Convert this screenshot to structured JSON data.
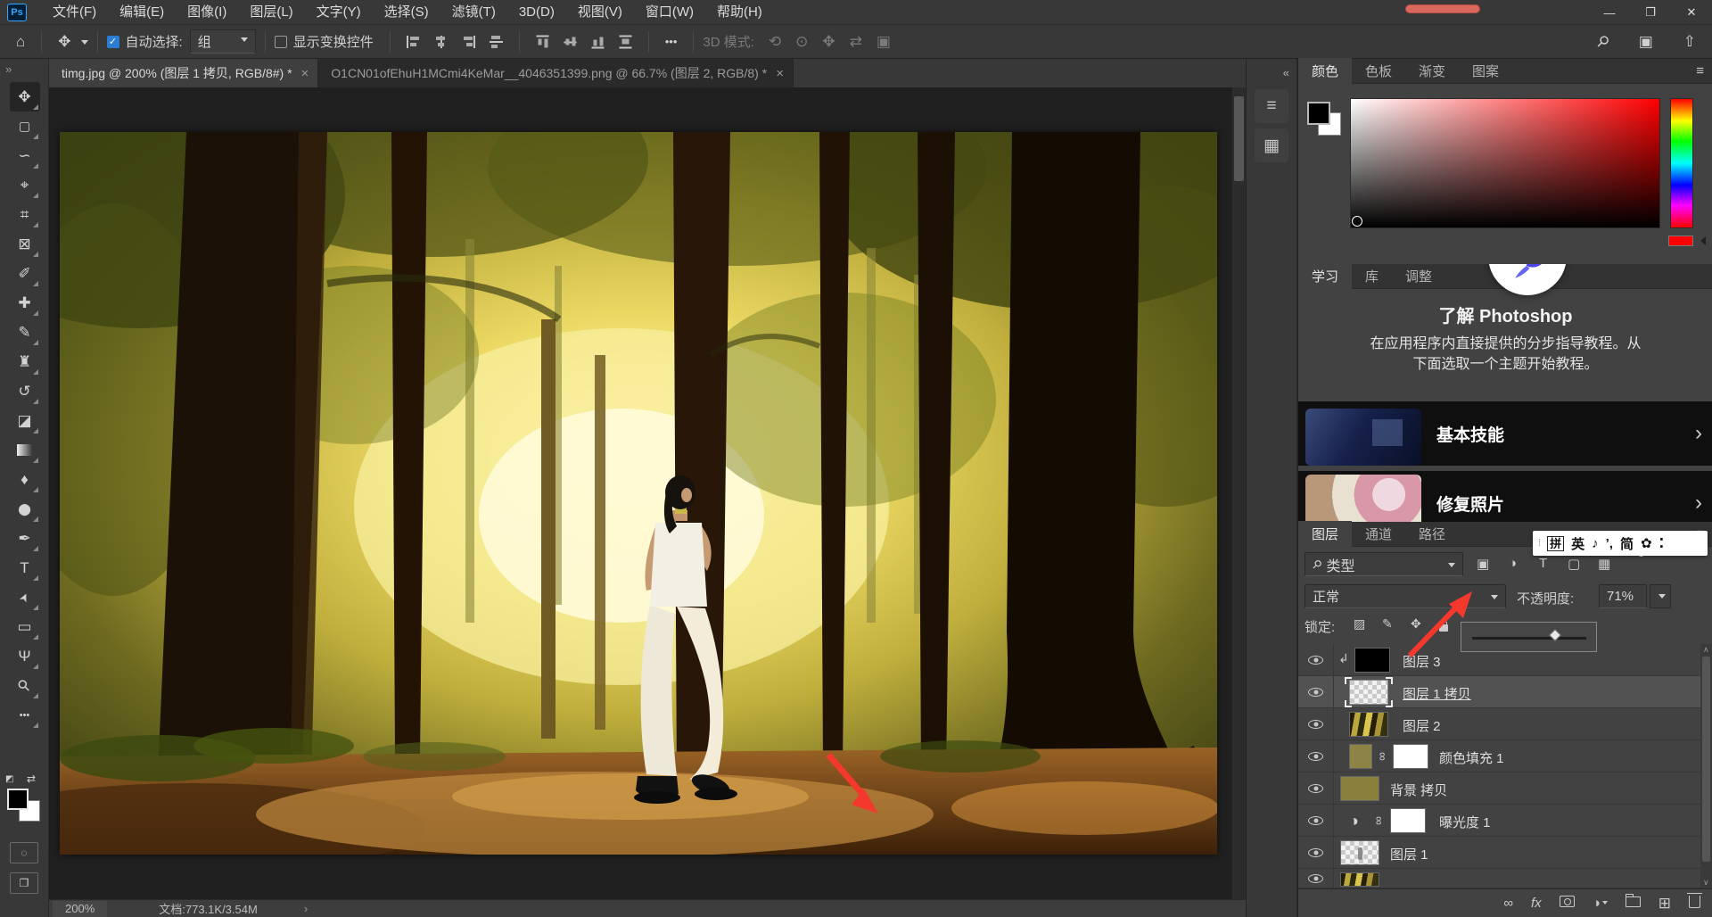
{
  "window": {
    "logo": "Ps",
    "controls": {
      "minimize": "—",
      "restore": "❐",
      "close": "✕"
    }
  },
  "menu": {
    "items": [
      "文件(F)",
      "编辑(E)",
      "图像(I)",
      "图层(L)",
      "文字(Y)",
      "选择(S)",
      "滤镜(T)",
      "3D(D)",
      "视图(V)",
      "窗口(W)",
      "帮助(H)"
    ]
  },
  "options": {
    "home_glyph": "⌂",
    "move_glyph": "✥",
    "check_glyph": "✓",
    "auto_select_label": "自动选择:",
    "auto_select_value": "组",
    "show_transform_label": "显示变换控件",
    "more_glyph": "•••",
    "mode3d_label": "3D 模式:",
    "mode3d_icons": [
      "⟲",
      "⊙",
      "✥",
      "⇄",
      "▣"
    ],
    "right_icons": {
      "search": "⚲",
      "workspace": "▣",
      "share": "⇧"
    }
  },
  "tabs": [
    {
      "title": "timg.jpg @ 200% (图层 1 拷贝, RGB/8#) *",
      "close_glyph": "×",
      "active": true
    },
    {
      "title": "O1CN01ofEhuH1MCmi4KeMar__4046351399.png @ 66.7% (图层 2, RGB/8) *",
      "close_glyph": "×",
      "active": false
    }
  ],
  "toolbar": {
    "collapse_glyph": "»",
    "tools": [
      {
        "name": "move",
        "glyph": "✥"
      },
      {
        "name": "rectangular-marquee",
        "glyph": "▢"
      },
      {
        "name": "lasso",
        "glyph": "∽"
      },
      {
        "name": "object-selection",
        "glyph": "⌖"
      },
      {
        "name": "crop",
        "glyph": "⌗"
      },
      {
        "name": "frame",
        "glyph": "⊠"
      },
      {
        "name": "eyedropper",
        "glyph": "✐"
      },
      {
        "name": "spot-healing-brush",
        "glyph": "✚"
      },
      {
        "name": "brush",
        "glyph": "✎"
      },
      {
        "name": "clone-stamp",
        "glyph": "♜"
      },
      {
        "name": "history-brush",
        "glyph": "↺"
      },
      {
        "name": "eraser",
        "glyph": "◪"
      },
      {
        "name": "gradient",
        "glyph": "■"
      },
      {
        "name": "blur",
        "glyph": "♦"
      },
      {
        "name": "dodge",
        "glyph": "⬤"
      },
      {
        "name": "pen",
        "glyph": "✒"
      },
      {
        "name": "horizontal-type",
        "glyph": "T"
      },
      {
        "name": "path-selection",
        "glyph": "➤"
      },
      {
        "name": "rectangle",
        "glyph": "▭"
      },
      {
        "name": "hand",
        "glyph": "Ψ"
      },
      {
        "name": "zoom",
        "glyph": "⚲"
      },
      {
        "name": "edit-toolbar",
        "glyph": "•••"
      }
    ],
    "quick_mask_glyph": "◌",
    "screen_mode_glyph": "❐"
  },
  "dock": {
    "collapse_glyph": "«",
    "icon1": "≡",
    "icon2": "▦"
  },
  "color_panel": {
    "tabs": [
      "颜色",
      "色板",
      "渐变",
      "图案"
    ],
    "menu_glyph": "≡",
    "fg_color": "#000000",
    "bg_color": "#ffffff",
    "hue_selected": "#ff0000"
  },
  "learn_panel": {
    "tabs": [
      "学习",
      "库",
      "调整"
    ],
    "heading": "了解 Photoshop",
    "body_line1": "在应用程序内直接提供的分步指导教程。从",
    "body_line2": "下面选取一个主题开始教程。",
    "cards": [
      {
        "title": "基本技能",
        "chevron": "›"
      },
      {
        "title": "修复照片",
        "chevron": "›"
      }
    ]
  },
  "layers_panel": {
    "tabs": [
      "图层",
      "通道",
      "路径"
    ],
    "menu_glyph": "≡",
    "search_glyph": "⚲",
    "filter_label": "类型",
    "filter_icons": [
      "▣",
      "◑",
      "T",
      "▢",
      "▦"
    ],
    "blend_mode": "正常",
    "opacity_label": "不透明度:",
    "opacity_value": "71%",
    "lock_label": "锁定:",
    "lock_icons": [
      "▨",
      "✎",
      "✥"
    ],
    "chain_glyph": "∞",
    "clip_glyph": "↳",
    "adjustment_glyph": "◑",
    "layers": [
      {
        "name": "图层 3",
        "clipped": true,
        "thumb": "black"
      },
      {
        "name": "图层 1 拷贝",
        "selected": true,
        "thumb": "transparent"
      },
      {
        "name": "图层 2",
        "thumb": "forest"
      },
      {
        "name": "颜色填充 1",
        "thumb": "olive",
        "linked": true,
        "has_mask": true
      },
      {
        "name": "背景 拷贝",
        "thumb": "olive"
      },
      {
        "name": "曝光度 1",
        "thumb": "adjustment",
        "linked": true,
        "has_mask": true
      },
      {
        "name": "图层 1",
        "thumb": "transparent-figure"
      }
    ],
    "bottom_icons": {
      "link": "∞",
      "fx": "fx",
      "adjustment": "◑",
      "new_layer": "⊞"
    }
  },
  "ime_bar": {
    "items": [
      "拼",
      "英",
      "♪",
      "’,",
      "简",
      "✿",
      "⁚"
    ]
  },
  "status_bar": {
    "zoom_level": "200%",
    "doc_info": "文档:773.1K/3.54M",
    "chevron": "›"
  },
  "colors": {
    "annotation_arrow": "#f4392c",
    "accent_blue": "#2b7cd3",
    "olive_swatch": "#8d8345"
  }
}
